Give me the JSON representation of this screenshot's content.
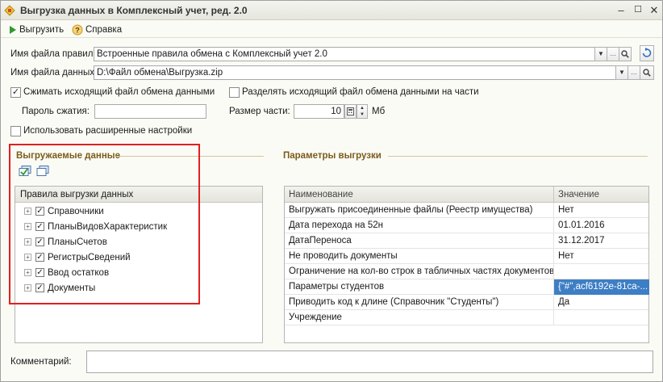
{
  "window": {
    "title": "Выгрузка данных в Комплексный учет, ред. 2.0"
  },
  "toolbar": {
    "export_label": "Выгрузить",
    "help_label": "Справка"
  },
  "form": {
    "rules_file_label": "Имя файла правил:",
    "rules_file_value": "Встроенные правила обмена с Комплексный учет 2.0",
    "data_file_label": "Имя файла данных:",
    "data_file_value": "D:\\Файл обмена\\Выгрузка.zip",
    "compress_label": "Сжимать исходящий файл обмена данными",
    "compress_checked": true,
    "split_label": "Разделять исходящий файл обмена данными на части",
    "split_checked": false,
    "password_label": "Пароль сжатия:",
    "password_value": "",
    "part_size_label": "Размер части:",
    "part_size_value": "10",
    "part_size_unit": "Мб",
    "advanced_label": "Использовать расширенные настройки",
    "advanced_checked": false,
    "comment_label": "Комментарий:",
    "comment_value": ""
  },
  "export_data": {
    "title": "Выгружаемые данные",
    "tree_header": "Правила выгрузки данных",
    "items": [
      {
        "label": "Справочники",
        "checked": true
      },
      {
        "label": "ПланыВидовХарактеристик",
        "checked": true
      },
      {
        "label": "ПланыСчетов",
        "checked": true
      },
      {
        "label": "РегистрыСведений",
        "checked": true
      },
      {
        "label": "Ввод остатков",
        "checked": true
      },
      {
        "label": "Документы",
        "checked": true
      }
    ]
  },
  "params": {
    "title": "Параметры выгрузки",
    "col_name": "Наименование",
    "col_value": "Значение",
    "rows": [
      {
        "name": "Выгружать присоединенные файлы (Реестр имущества)",
        "value": "Нет"
      },
      {
        "name": "Дата перехода на 52н",
        "value": "01.01.2016"
      },
      {
        "name": "ДатаПереноса",
        "value": "31.12.2017"
      },
      {
        "name": "Не проводить документы",
        "value": "Нет"
      },
      {
        "name": "Ограничение на кол-во строк в табличных частях документов ...",
        "value": ""
      },
      {
        "name": "Параметры студентов",
        "value": "{\"#\",acf6192e-81ca-..."
      },
      {
        "name": "Приводить код к длине (Справочник \"Студенты\")",
        "value": "Да"
      },
      {
        "name": "Учреждение",
        "value": ""
      }
    ],
    "selected_row": 5,
    "selected_color": "#3d7ec4"
  }
}
